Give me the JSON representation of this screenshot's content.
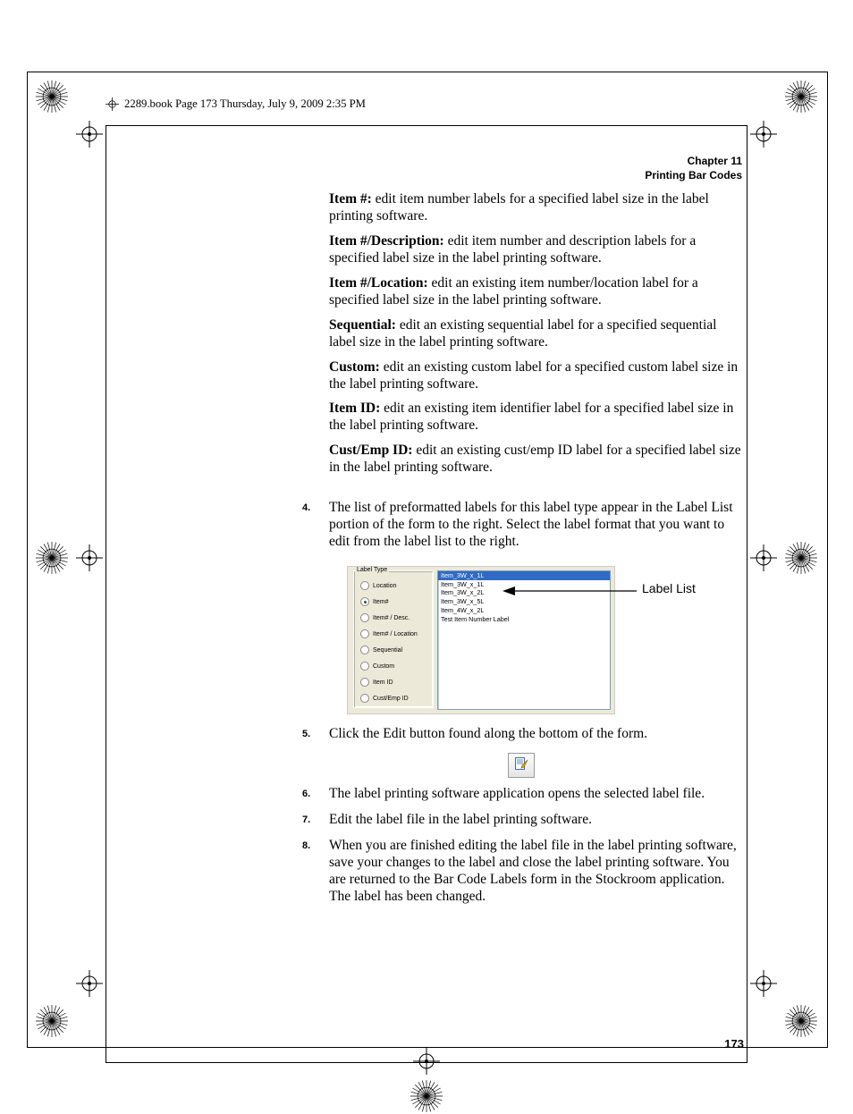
{
  "header_text": "2289.book  Page 173  Thursday, July 9, 2009  2:35 PM",
  "chapter_line1": "Chapter 11",
  "chapter_line2": "Printing Bar Codes",
  "defs": [
    {
      "term": "Item #:",
      "text": " edit item number labels for a specified label size in the label printing software."
    },
    {
      "term": "Item #/Description:",
      "text": " edit item number and description labels for a specified label size in the label printing software."
    },
    {
      "term": "Item #/Location:",
      "text": " edit an existing item number/location label for a specified label size in the label printing software."
    },
    {
      "term": "Sequential:",
      "text": " edit an existing sequential label for a specified sequential label size in the label printing software."
    },
    {
      "term": "Custom:",
      "text": " edit an existing custom label for a specified custom label size in the label printing software."
    },
    {
      "term": "Item ID:",
      "text": " edit an existing item identifier label for a specified label size in the label printing software."
    },
    {
      "term": "Cust/Emp ID:",
      "text": " edit an existing cust/emp ID label for a specified label size in the label printing software."
    }
  ],
  "step4_num": "4.",
  "step4_text": "The list of preformatted labels for this label type appear in the Label List portion of the form to the right. Select the label format that you want to edit from the label list to the right.",
  "figure": {
    "group_legend": "Label Type",
    "radios": [
      {
        "label": "Location",
        "selected": false
      },
      {
        "label": "Item#",
        "selected": true
      },
      {
        "label": "Item# /  Desc.",
        "selected": false
      },
      {
        "label": "Item# / Location",
        "selected": false
      },
      {
        "label": "Sequential",
        "selected": false
      },
      {
        "label": "Custom",
        "selected": false
      },
      {
        "label": "Item ID",
        "selected": false
      },
      {
        "label": "Cust/Emp ID",
        "selected": false
      }
    ],
    "list_items": [
      {
        "label": "Item_3W_x_1L",
        "selected": true
      },
      {
        "label": "Item_3W_x_1L",
        "selected": false
      },
      {
        "label": "Item_3W_x_2L",
        "selected": false
      },
      {
        "label": "Item_3W_x_5L",
        "selected": false
      },
      {
        "label": "Item_4W_x_2L",
        "selected": false
      },
      {
        "label": "Test Item Number Label",
        "selected": false
      }
    ]
  },
  "annotation_label": "Label List",
  "step5_num": "5.",
  "step5_pre": "Click the ",
  "step5_bold": "Edit",
  "step5_post": " button found along the bottom of the form.",
  "step6_num": "6.",
  "step6_text": "The label printing software application opens the selected label file.",
  "step7_num": "7.",
  "step7_text": "Edit the label file in the label printing software.",
  "step8_num": "8.",
  "step8_text": "When you are finished editing the label file in the label printing software, save your changes to the label and close the label printing software. You are returned to the Bar Code Labels form in the Stockroom application. The label has been changed.",
  "page_number": "173"
}
